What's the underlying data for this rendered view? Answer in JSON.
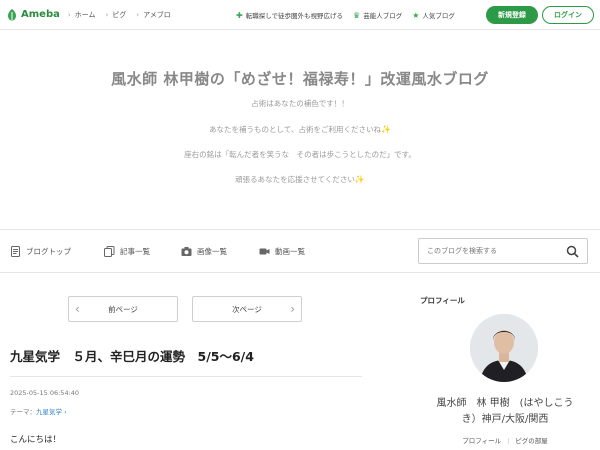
{
  "topbar": {
    "brand": "Ameba",
    "crumbs": [
      "ホーム",
      "ピグ",
      "アメブロ"
    ],
    "links": [
      {
        "label": "転職探しで徒歩圏外も視野広げる",
        "icon": "plus-icon"
      },
      {
        "label": "芸能人ブログ",
        "icon": "crown-icon"
      },
      {
        "label": "人気ブログ",
        "icon": "star-icon"
      }
    ],
    "register_label": "新規登録",
    "login_label": "ログイン"
  },
  "blog": {
    "title": "風水師 林甲樹の「めざせ！福禄寿！」改運風水ブログ",
    "desc1": "占術はあなたの補色です！！",
    "desc2": "あなたを補うものとして、占術をご利用くださいね",
    "desc3": "座右の銘は「転んだ者を笑うな　その者は歩こうとしたのだ」です。",
    "desc4": "頑張るあなたを応援させてください"
  },
  "nav": {
    "items": [
      "ブログトップ",
      "記事一覧",
      "画像一覧",
      "動画一覧"
    ],
    "search_placeholder": "このブログを検索する"
  },
  "pager": {
    "prev_label": "前ページ",
    "next_label": "次ページ"
  },
  "post": {
    "title": "九星気学　５月、辛巳月の運勢　5/5〜6/4",
    "date": "2025-05-15 06:54:40",
    "theme_prefix": "テーマ：",
    "theme": "九星気学",
    "body_first_line": "こんにちは！"
  },
  "sidebar": {
    "heading": "プロフィール",
    "name_line1": "風水師　林 甲樹　(はやしこう",
    "name_line2": "き）神戸/大阪/関西",
    "link_profile": "プロフィール",
    "link_room": "ピグの部屋"
  },
  "colors": {
    "accent": "#2c9a46",
    "link": "#2c7fcf"
  }
}
